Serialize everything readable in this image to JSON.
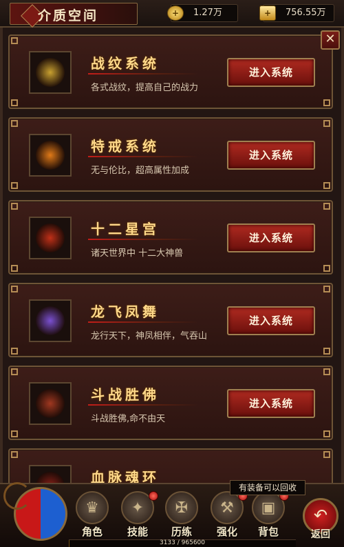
{
  "header": {
    "title": "介质空间",
    "currency_1": {
      "icon": "gold-coin-plus-icon",
      "value": "1.27万"
    },
    "currency_2": {
      "icon": "gold-ingot-plus-icon",
      "value": "756.55万"
    }
  },
  "close_label": "✕",
  "systems": [
    {
      "title": "战纹系统",
      "desc": "各式战纹，提高自己的战力",
      "button": "进入系统",
      "icon": "battle-pattern-icon",
      "color": "#c8a030"
    },
    {
      "title": "特戒系统",
      "desc": "无与伦比，超高属性加成",
      "button": "进入系统",
      "icon": "special-ring-icon",
      "color": "#e07a18"
    },
    {
      "title": "十二星宫",
      "desc": "诸天世界中 十二大神兽",
      "button": "进入系统",
      "icon": "zodiac-beast-icon",
      "color": "#c03018"
    },
    {
      "title": "龙飞凤舞",
      "desc": "龙行天下，神凤相伴，气吞山",
      "button": "进入系统",
      "icon": "dragon-phoenix-icon",
      "color": "#7a50d0"
    },
    {
      "title": "斗战胜佛",
      "desc": "斗战胜佛,命不由天",
      "button": "进入系统",
      "icon": "monkey-king-icon",
      "color": "#a03820"
    },
    {
      "title": "血脉魂环",
      "desc": "",
      "button": "",
      "icon": "blood-soul-ring-icon",
      "color": "#8a2018"
    }
  ],
  "tooltip": "有装备可以回收",
  "nav": [
    {
      "label": "角色",
      "icon": "character-icon",
      "glyph": "♛",
      "alert": false
    },
    {
      "label": "技能",
      "icon": "skill-book-icon",
      "glyph": "✦",
      "alert": true
    },
    {
      "label": "历练",
      "icon": "training-icon",
      "glyph": "✠",
      "alert": false
    },
    {
      "label": "强化",
      "icon": "forge-hammer-icon",
      "glyph": "⚒",
      "alert": true
    },
    {
      "label": "背包",
      "icon": "backpack-chest-icon",
      "glyph": "▣",
      "alert": true
    }
  ],
  "back": {
    "label": "返回",
    "glyph": "↶"
  },
  "xp": {
    "text": "3133 / 965600",
    "progress": 0.003
  }
}
